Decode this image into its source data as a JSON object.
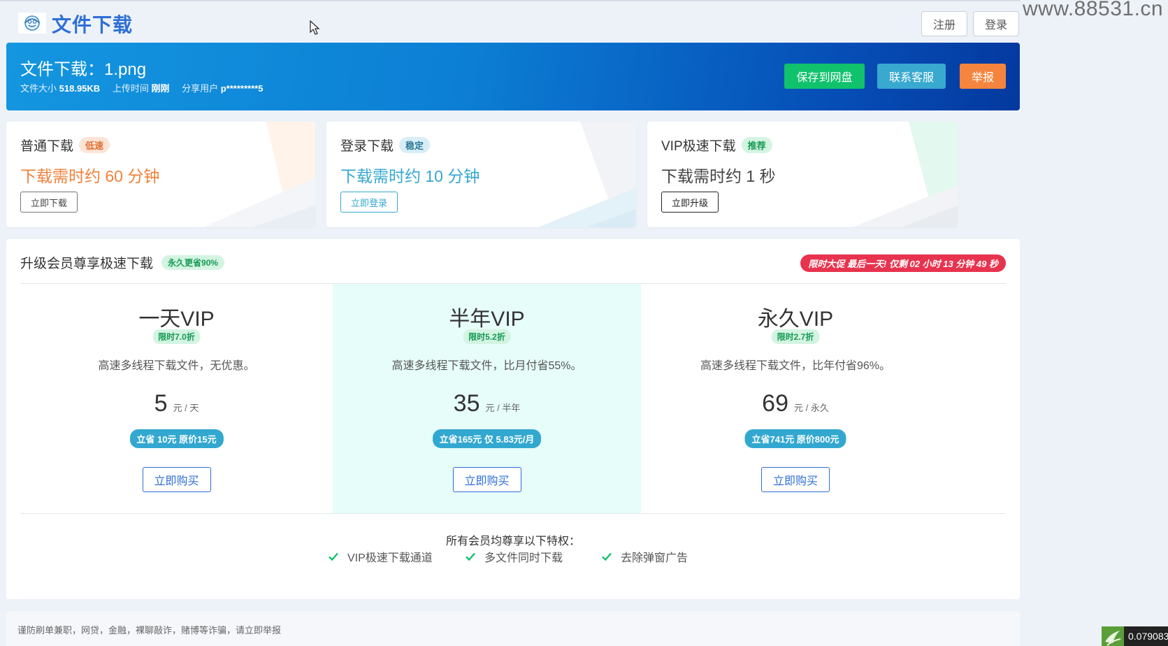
{
  "header": {
    "site_title": "文件下载",
    "register_label": "注册",
    "login_label": "登录"
  },
  "watermark": "www.88531.cn",
  "banner": {
    "file_title": "文件下载：1.png",
    "size_label": "文件大小",
    "size_value": "518.95KB",
    "upload_label": "上传时间",
    "upload_value": "刚刚",
    "share_label": "分享用户",
    "share_value": "p*********5",
    "save_label": "保存到网盘",
    "contact_label": "联系客服",
    "report_label": "举报"
  },
  "download_options": [
    {
      "title": "普通下载",
      "tag": "低速",
      "time": "下载需时约 60 分钟",
      "button": "立即下载",
      "color": "#f0813a"
    },
    {
      "title": "登录下载",
      "tag": "稳定",
      "time": "下载需时约 10 分钟",
      "button": "立即登录",
      "color": "#35a7cf"
    },
    {
      "title": "VIP极速下载",
      "tag": "推荐",
      "time": "下载需时约 1 秒",
      "button": "立即升级",
      "color": "#444444"
    }
  ],
  "vip": {
    "title": "升级会员尊享极速下载",
    "title_tag": "永久更省90%",
    "promo": "限时大促 最后一天! 仅剩 02 小时 13 分钟 49 秒",
    "plans": [
      {
        "name": "一天VIP",
        "discount": "限时7.0折",
        "desc": "高速多线程下载文件，无优惠。",
        "price": "5",
        "unit": "元 / 天",
        "save": "立省 10元 原价15元",
        "buy": "立即购买"
      },
      {
        "name": "半年VIP",
        "discount": "限时5.2折",
        "desc": "高速多线程下载文件，比月付省55%。",
        "price": "35",
        "unit": "元 / 半年",
        "save": "立省165元 仅 5.83元/月",
        "buy": "立即购买"
      },
      {
        "name": "永久VIP",
        "discount": "限时2.7折",
        "desc": "高速多线程下载文件，比年付省96%。",
        "price": "69",
        "unit": "元 / 永久",
        "save": "立省741元 原价800元",
        "buy": "立即购买"
      }
    ],
    "perks_title": "所有会员均尊享以下特权：",
    "perks": [
      "VIP极速下载通道",
      "多文件同时下载",
      "去除弹窗广告"
    ]
  },
  "footer": {
    "warning": "谨防刷单兼职，网贷，金融，裸聊敲诈，赌博等诈骗，请立即举报"
  },
  "corner_badge": "0.079083",
  "colors": {
    "accent": "#2f6fd6",
    "save": "#10c26c",
    "contact": "#39a9d0",
    "report": "#f5853e",
    "promo": "#e8334e",
    "check": "#10c26c"
  }
}
